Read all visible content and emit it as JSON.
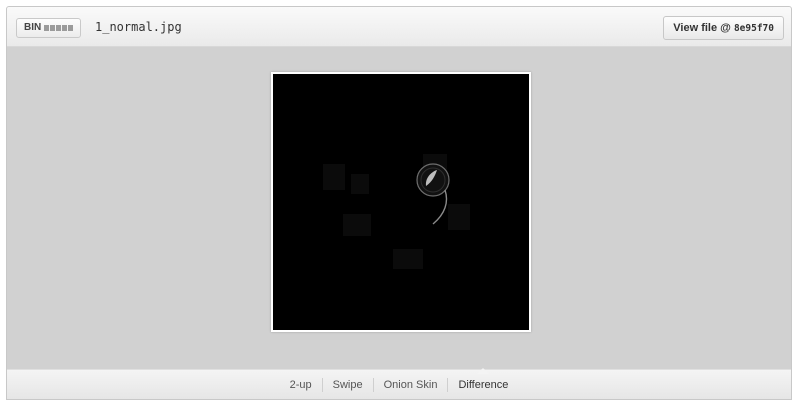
{
  "header": {
    "badge_label": "BIN",
    "badge_icon": "bars-icon",
    "filename": "1_normal.jpg",
    "view_button_label": "View file @",
    "view_button_sha": "8e95f70"
  },
  "viewer": {
    "background": "#000000",
    "description_icon": "difference-image"
  },
  "modes": {
    "tabs": [
      {
        "label": "2-up"
      },
      {
        "label": "Swipe"
      },
      {
        "label": "Onion Skin"
      },
      {
        "label": "Difference"
      }
    ],
    "active": "Difference"
  },
  "colors": {
    "panel": "#d1d1d1",
    "header": "#f2f2f2",
    "image": "#000000"
  }
}
